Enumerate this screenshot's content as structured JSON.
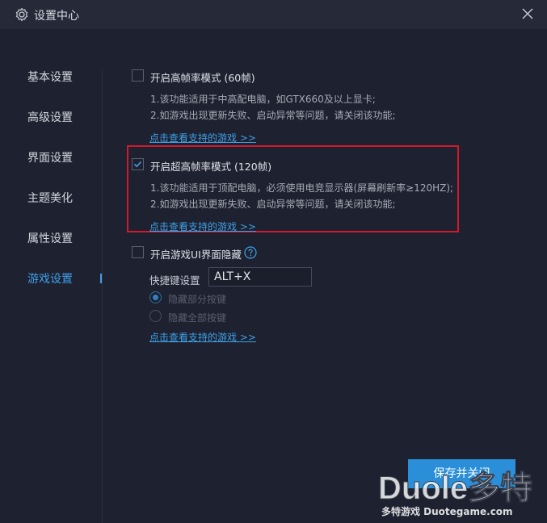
{
  "window": {
    "title": "设置中心"
  },
  "sidebar": {
    "items": [
      {
        "label": "基本设置"
      },
      {
        "label": "高级设置"
      },
      {
        "label": "界面设置"
      },
      {
        "label": "主题美化"
      },
      {
        "label": "属性设置"
      },
      {
        "label": "游戏设置",
        "active": true
      }
    ]
  },
  "game_settings": {
    "high_fps": {
      "label": "开启高帧率模式 (60帧)",
      "checked": false,
      "desc1": "1.该功能适用于中高配电脑，如GTX660及以上显卡;",
      "desc2": "2.如游戏出现更新失败、启动异常等问题，请关闭该功能;",
      "link": "点击查看支持的游戏 >>"
    },
    "ultra_fps": {
      "label": "开启超高帧率模式 (120帧)",
      "checked": true,
      "desc1": "1.该功能适用于顶配电脑，必须使用电竞显示器(屏幕刷新率≥120HZ);",
      "desc2": "2.如游戏出现更新失败、启动异常等问题，请关闭该功能;",
      "link": "点击查看支持的游戏 >>"
    },
    "hide_ui": {
      "label": "开启游戏UI界面隐藏",
      "checked": false,
      "hotkey_label": "快捷键设置",
      "hotkey_value": "ALT+X",
      "radio_partial": "隐藏部分按键",
      "radio_all": "隐藏全部按键",
      "link": "点击查看支持的游戏 >>"
    }
  },
  "footer": {
    "save_label": "保存并关闭"
  },
  "watermark": {
    "brand": "Duole多特",
    "sub": "多特游戏 Duotegame.com"
  },
  "colors": {
    "accent": "#3fa0e6",
    "button": "#2a8fd8",
    "highlight": "#d0192b",
    "background": "#1d2130"
  }
}
